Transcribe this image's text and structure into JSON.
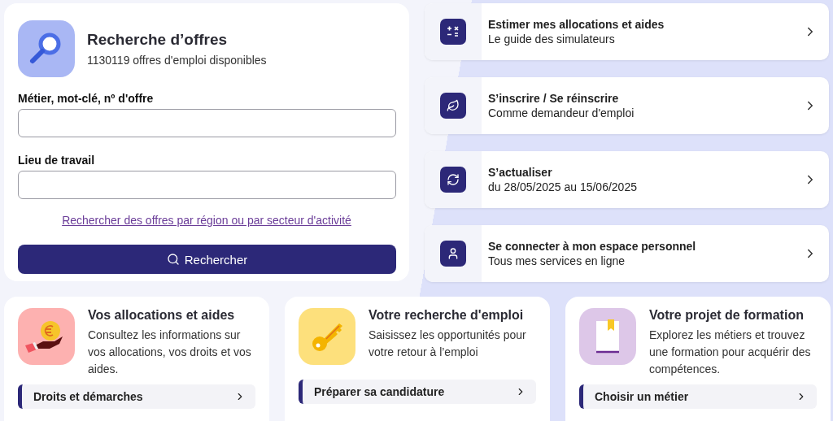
{
  "search": {
    "title": "Recherche d’offres",
    "subtitle": "1130119 offres d'emploi disponibles",
    "fields": [
      {
        "label": "Métier, mot-clé, nº d'offre"
      },
      {
        "label": "Lieu de travail"
      }
    ],
    "link": "Rechercher des offres par région ou par secteur d'activité",
    "button": "Rechercher"
  },
  "shortcuts": [
    {
      "kind": "calculator",
      "title": "Estimer mes allocations et aides",
      "subtitle": "Le guide des simulateurs"
    },
    {
      "kind": "leaf",
      "title": "S’inscrire / Se réinscrire",
      "subtitle": "Comme demandeur d'emploi"
    },
    {
      "kind": "refresh",
      "title": "S’actualiser",
      "subtitle": "du 28/05/2025 au 15/06/2025"
    },
    {
      "kind": "user",
      "title": "Se connecter à mon espace personnel",
      "subtitle": "Tous mes services en ligne"
    }
  ],
  "topics": [
    {
      "kind": "allocations",
      "title": "Vos allocations et aides",
      "text": "Consultez les informations sur vos allocations, vos droits et vos aides.",
      "link": "Droits et démarches"
    },
    {
      "kind": "key",
      "title": "Votre recherche d'emploi",
      "text": "Saisissez les opportunités pour votre retour à l’emploi",
      "link": "Préparer sa candidature"
    },
    {
      "kind": "book",
      "title": "Votre projet de formation",
      "text": "Explorez les métiers et trouvez une formation pour acquérir des compétences.",
      "link": "Choisir un métier"
    }
  ]
}
